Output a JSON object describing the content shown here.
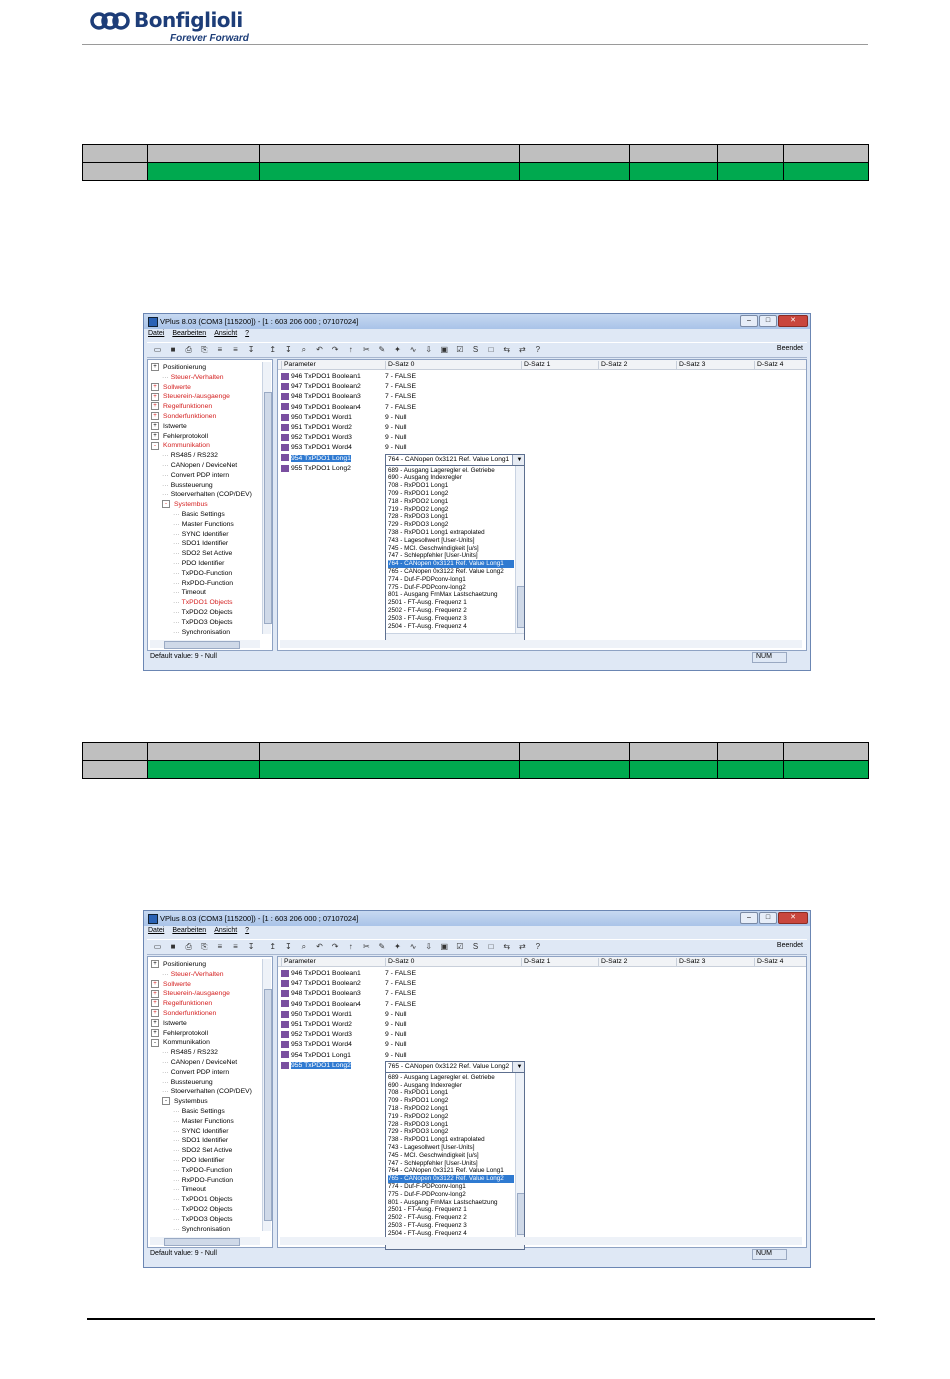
{
  "header": {
    "logo_text": "Bonfiglioli",
    "logo_tagline": "Forever Forward",
    "brand_color": "#1d3d78"
  },
  "colors": {
    "table_green": "#00a94f",
    "table_grey": "#bfbfbf"
  },
  "screens": [
    {
      "window_title": "VPlus 8.03 (COM3 [115200]) - [1 :  603 206 000 ; 07107024]",
      "menu": [
        "Datei",
        "Bearbeiten",
        "Ansicht",
        "?"
      ],
      "toolbar_right": "Beendet",
      "tree": [
        {
          "label": "Positionierung",
          "expander": "+",
          "red": false,
          "indent": 0
        },
        {
          "label": "Steuer-/Verhalten",
          "expander": "",
          "red": true,
          "indent": 1
        },
        {
          "label": "Sollwerte",
          "expander": "+",
          "red": true,
          "indent": 0
        },
        {
          "label": "Steuerein-/ausgaenge",
          "expander": "+",
          "red": true,
          "indent": 0
        },
        {
          "label": "Regelfunktionen",
          "expander": "+",
          "red": true,
          "indent": 0
        },
        {
          "label": "Sonderfunktionen",
          "expander": "+",
          "red": true,
          "indent": 0
        },
        {
          "label": "Istwerte",
          "expander": "+",
          "red": false,
          "indent": 0
        },
        {
          "label": "Fehlerprotokoll",
          "expander": "+",
          "red": false,
          "indent": 0
        },
        {
          "label": "Kommunikation",
          "expander": "-",
          "red": true,
          "indent": 0
        },
        {
          "label": "RS485 / RS232",
          "expander": "",
          "red": false,
          "indent": 1
        },
        {
          "label": "CANopen / DeviceNet",
          "expander": "",
          "red": false,
          "indent": 1
        },
        {
          "label": "Convert PDP intern",
          "expander": "",
          "red": false,
          "indent": 1
        },
        {
          "label": "Bussteuerung",
          "expander": "",
          "red": false,
          "indent": 1
        },
        {
          "label": "Stoerverhalten (COP/DEV)",
          "expander": "",
          "red": false,
          "indent": 1
        },
        {
          "label": "Systembus",
          "expander": "-",
          "red": true,
          "indent": 1
        },
        {
          "label": "Basic Settings",
          "expander": "",
          "red": false,
          "indent": 2
        },
        {
          "label": "Master Functions",
          "expander": "",
          "red": false,
          "indent": 2
        },
        {
          "label": "SYNC Identifier",
          "expander": "",
          "red": false,
          "indent": 2
        },
        {
          "label": "SDO1 Identifier",
          "expander": "",
          "red": false,
          "indent": 2
        },
        {
          "label": "SDO2 Set Active",
          "expander": "",
          "red": false,
          "indent": 2
        },
        {
          "label": "PDO Identifier",
          "expander": "",
          "red": false,
          "indent": 2
        },
        {
          "label": "TxPDO-Function",
          "expander": "",
          "red": false,
          "indent": 2
        },
        {
          "label": "RxPDO-Function",
          "expander": "",
          "red": false,
          "indent": 2
        },
        {
          "label": "Timeout",
          "expander": "",
          "red": false,
          "indent": 2
        },
        {
          "label": "TxPDO1 Objects",
          "expander": "",
          "red": true,
          "indent": 2
        },
        {
          "label": "TxPDO2 Objects",
          "expander": "",
          "red": false,
          "indent": 2
        },
        {
          "label": "TxPDO3 Objects",
          "expander": "",
          "red": false,
          "indent": 2
        },
        {
          "label": "Synchronisation",
          "expander": "",
          "red": false,
          "indent": 2
        }
      ],
      "grid_headers": [
        "Parameter",
        "D-Satz 0",
        "D-Satz 1",
        "D-Satz 2",
        "D-Satz 3",
        "D-Satz 4"
      ],
      "params": [
        {
          "name": "946  TxPDO1 Boolean1",
          "value": "7 - FALSE",
          "selected": false
        },
        {
          "name": "947  TxPDO1 Boolean2",
          "value": "7 - FALSE",
          "selected": false
        },
        {
          "name": "948  TxPDO1 Boolean3",
          "value": "7 - FALSE",
          "selected": false
        },
        {
          "name": "949  TxPDO1 Boolean4",
          "value": "7 - FALSE",
          "selected": false
        },
        {
          "name": "950  TxPDO1 Word1",
          "value": "9 - Null",
          "selected": false
        },
        {
          "name": "951  TxPDO1 Word2",
          "value": "9 - Null",
          "selected": false
        },
        {
          "name": "952  TxPDO1 Word3",
          "value": "9 - Null",
          "selected": false
        },
        {
          "name": "953  TxPDO1 Word4",
          "value": "9 - Null",
          "selected": false
        },
        {
          "name": "954  TxPDO1 Long1",
          "value": "",
          "selected": true
        },
        {
          "name": "955  TxPDO1 Long2",
          "value": "",
          "selected": false
        }
      ],
      "combo_value": "764 - CANopen 0x3121 Ref. Value Long1",
      "dropdown": [
        {
          "text": "689 - Ausgang Lageregler el. Getriebe",
          "selected": false
        },
        {
          "text": "690 - Ausgang Indexregler",
          "selected": false
        },
        {
          "text": "708 - RxPDO1 Long1",
          "selected": false
        },
        {
          "text": "709 - RxPDO1 Long2",
          "selected": false
        },
        {
          "text": "718 - RxPDO2 Long1",
          "selected": false
        },
        {
          "text": "719 - RxPDO2 Long2",
          "selected": false
        },
        {
          "text": "728 - RxPDO3 Long1",
          "selected": false
        },
        {
          "text": "729 - RxPDO3 Long2",
          "selected": false
        },
        {
          "text": "738 - RxPDO1 Long1 extrapolated",
          "selected": false
        },
        {
          "text": "743 - Lagesollwert [User-Units]",
          "selected": false
        },
        {
          "text": "745 - MCI. Geschwindigkeit [u/s]",
          "selected": false
        },
        {
          "text": "747 - Schleppfehler [User-Units]",
          "selected": false
        },
        {
          "text": "764 - CANopen 0x3121 Ref. Value Long1",
          "selected": true
        },
        {
          "text": "765 - CANopen 0x3122 Ref. Value Long2",
          "selected": false
        },
        {
          "text": "774 - Duf-F-PDPconv-long1",
          "selected": false
        },
        {
          "text": "775 - Duf-F-PDPconv-long2",
          "selected": false
        },
        {
          "text": "801 - Ausgang FrnMax Lastschaetzung",
          "selected": false
        },
        {
          "text": "2501 - FT-Ausg. Frequenz 1",
          "selected": false
        },
        {
          "text": "2502 - FT-Ausg. Frequenz 2",
          "selected": false
        },
        {
          "text": "2503 - FT-Ausg. Frequenz 3",
          "selected": false
        },
        {
          "text": "2504 - FT-Ausg. Frequenz 4",
          "selected": false
        }
      ],
      "status_text": "Default value: 9 - Null",
      "status_num": "NUM"
    },
    {
      "window_title": "VPlus 8.03 (COM3 [115200]) - [1 :  603 206 000 ; 07107024]",
      "menu": [
        "Datei",
        "Bearbeiten",
        "Ansicht",
        "?"
      ],
      "toolbar_right": "Beendet",
      "tree": [
        {
          "label": "Positionierung",
          "expander": "+",
          "red": false,
          "indent": 0
        },
        {
          "label": "Steuer-/Verhalten",
          "expander": "",
          "red": true,
          "indent": 1
        },
        {
          "label": "Sollwerte",
          "expander": "+",
          "red": true,
          "indent": 0
        },
        {
          "label": "Steuerein-/ausgaenge",
          "expander": "+",
          "red": true,
          "indent": 0
        },
        {
          "label": "Regelfunktionen",
          "expander": "+",
          "red": true,
          "indent": 0
        },
        {
          "label": "Sonderfunktionen",
          "expander": "+",
          "red": true,
          "indent": 0
        },
        {
          "label": "Istwerte",
          "expander": "+",
          "red": false,
          "indent": 0
        },
        {
          "label": "Fehlerprotokoll",
          "expander": "+",
          "red": false,
          "indent": 0
        },
        {
          "label": "Kommunikation",
          "expander": "-",
          "red": false,
          "indent": 0
        },
        {
          "label": "RS485 / RS232",
          "expander": "",
          "red": false,
          "indent": 1
        },
        {
          "label": "CANopen / DeviceNet",
          "expander": "",
          "red": false,
          "indent": 1
        },
        {
          "label": "Convert PDP intern",
          "expander": "",
          "red": false,
          "indent": 1
        },
        {
          "label": "Bussteuerung",
          "expander": "",
          "red": false,
          "indent": 1
        },
        {
          "label": "Stoerverhalten (COP/DEV)",
          "expander": "",
          "red": false,
          "indent": 1
        },
        {
          "label": "Systembus",
          "expander": "-",
          "red": false,
          "indent": 1
        },
        {
          "label": "Basic Settings",
          "expander": "",
          "red": false,
          "indent": 2
        },
        {
          "label": "Master Functions",
          "expander": "",
          "red": false,
          "indent": 2
        },
        {
          "label": "SYNC Identifier",
          "expander": "",
          "red": false,
          "indent": 2
        },
        {
          "label": "SDO1 Identifier",
          "expander": "",
          "red": false,
          "indent": 2
        },
        {
          "label": "SDO2 Set Active",
          "expander": "",
          "red": false,
          "indent": 2
        },
        {
          "label": "PDO Identifier",
          "expander": "",
          "red": false,
          "indent": 2
        },
        {
          "label": "TxPDO-Function",
          "expander": "",
          "red": false,
          "indent": 2
        },
        {
          "label": "RxPDO-Function",
          "expander": "",
          "red": false,
          "indent": 2
        },
        {
          "label": "Timeout",
          "expander": "",
          "red": false,
          "indent": 2
        },
        {
          "label": "TxPDO1 Objects",
          "expander": "",
          "red": false,
          "indent": 2
        },
        {
          "label": "TxPDO2 Objects",
          "expander": "",
          "red": false,
          "indent": 2
        },
        {
          "label": "TxPDO3 Objects",
          "expander": "",
          "red": false,
          "indent": 2
        },
        {
          "label": "Synchronisation",
          "expander": "",
          "red": false,
          "indent": 2
        }
      ],
      "grid_headers": [
        "Parameter",
        "D-Satz 0",
        "D-Satz 1",
        "D-Satz 2",
        "D-Satz 3",
        "D-Satz 4"
      ],
      "params": [
        {
          "name": "946  TxPDO1 Boolean1",
          "value": "7 - FALSE",
          "selected": false
        },
        {
          "name": "947  TxPDO1 Boolean2",
          "value": "7 - FALSE",
          "selected": false
        },
        {
          "name": "948  TxPDO1 Boolean3",
          "value": "7 - FALSE",
          "selected": false
        },
        {
          "name": "949  TxPDO1 Boolean4",
          "value": "7 - FALSE",
          "selected": false
        },
        {
          "name": "950  TxPDO1 Word1",
          "value": "9 - Null",
          "selected": false
        },
        {
          "name": "951  TxPDO1 Word2",
          "value": "9 - Null",
          "selected": false
        },
        {
          "name": "952  TxPDO1 Word3",
          "value": "9 - Null",
          "selected": false
        },
        {
          "name": "953  TxPDO1 Word4",
          "value": "9 - Null",
          "selected": false
        },
        {
          "name": "954  TxPDO1 Long1",
          "value": "9 - Null",
          "selected": false
        },
        {
          "name": "955  TxPDO1 Long2",
          "value": "",
          "selected": true
        }
      ],
      "combo_value": "765 - CANopen 0x3122 Ref. Value Long2",
      "dropdown": [
        {
          "text": "689 - Ausgang Lageregler el. Getriebe",
          "selected": false
        },
        {
          "text": "690 - Ausgang Indexregler",
          "selected": false
        },
        {
          "text": "708 - RxPDO1 Long1",
          "selected": false
        },
        {
          "text": "709 - RxPDO1 Long2",
          "selected": false
        },
        {
          "text": "718 - RxPDO2 Long1",
          "selected": false
        },
        {
          "text": "719 - RxPDO2 Long2",
          "selected": false
        },
        {
          "text": "728 - RxPDO3 Long1",
          "selected": false
        },
        {
          "text": "729 - RxPDO3 Long2",
          "selected": false
        },
        {
          "text": "738 - RxPDO1 Long1 extrapolated",
          "selected": false
        },
        {
          "text": "743 - Lagesollwert [User-Units]",
          "selected": false
        },
        {
          "text": "745 - MCI. Geschwindigkeit [u/s]",
          "selected": false
        },
        {
          "text": "747 - Schleppfehler [User-Units]",
          "selected": false
        },
        {
          "text": "764 - CANopen 0x3121 Ref. Value Long1",
          "selected": false
        },
        {
          "text": "765 - CANopen 0x3122 Ref. Value Long2",
          "selected": true
        },
        {
          "text": "774 - Duf-F-PDPconv-long1",
          "selected": false
        },
        {
          "text": "775 - Duf-F-PDPconv-long2",
          "selected": false
        },
        {
          "text": "801 - Ausgang FrnMax Lastschaetzung",
          "selected": false
        },
        {
          "text": "2501 - FT-Ausg. Frequenz 1",
          "selected": false
        },
        {
          "text": "2502 - FT-Ausg. Frequenz 2",
          "selected": false
        },
        {
          "text": "2503 - FT-Ausg. Frequenz 3",
          "selected": false
        },
        {
          "text": "2504 - FT-Ausg. Frequenz 4",
          "selected": false
        }
      ],
      "status_text": "Default value: 9 - Null",
      "status_num": "NUM"
    }
  ]
}
